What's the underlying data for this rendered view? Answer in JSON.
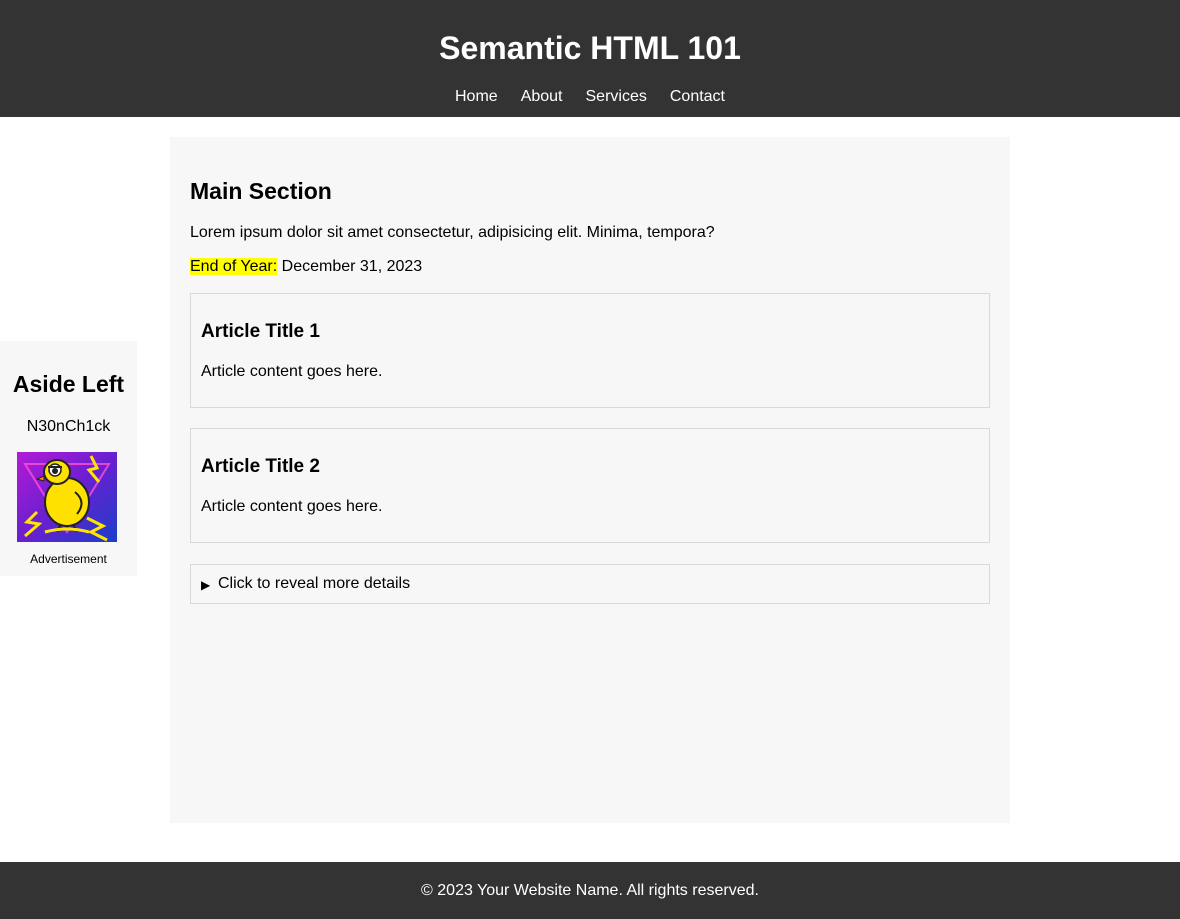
{
  "header": {
    "title": "Semantic HTML 101",
    "nav": [
      "Home",
      "About",
      "Services",
      "Contact"
    ]
  },
  "aside": {
    "title": "Aside Left",
    "name": "N30nCh1ck",
    "image_icon": "yellow-chick-advertisement-image",
    "caption": "Advertisement"
  },
  "main": {
    "title": "Main Section",
    "paragraph": "Lorem ipsum dolor sit amet consectetur, adipisicing elit. Minima, tempora?",
    "eoy_label": "End of Year:",
    "eoy_value": "December 31, 2023",
    "articles": [
      {
        "title": "Article Title 1",
        "body": "Article content goes here."
      },
      {
        "title": "Article Title 2",
        "body": "Article content goes here."
      }
    ],
    "details": {
      "arrow": "▶",
      "label": "Click to reveal more details"
    }
  },
  "footer": {
    "text": "© 2023 Your Website Name. All rights reserved."
  },
  "colors": {
    "header_bg": "#333333",
    "panel_bg": "#f7f7f7",
    "highlight": "#ffff00",
    "border": "#d9d9d9"
  }
}
